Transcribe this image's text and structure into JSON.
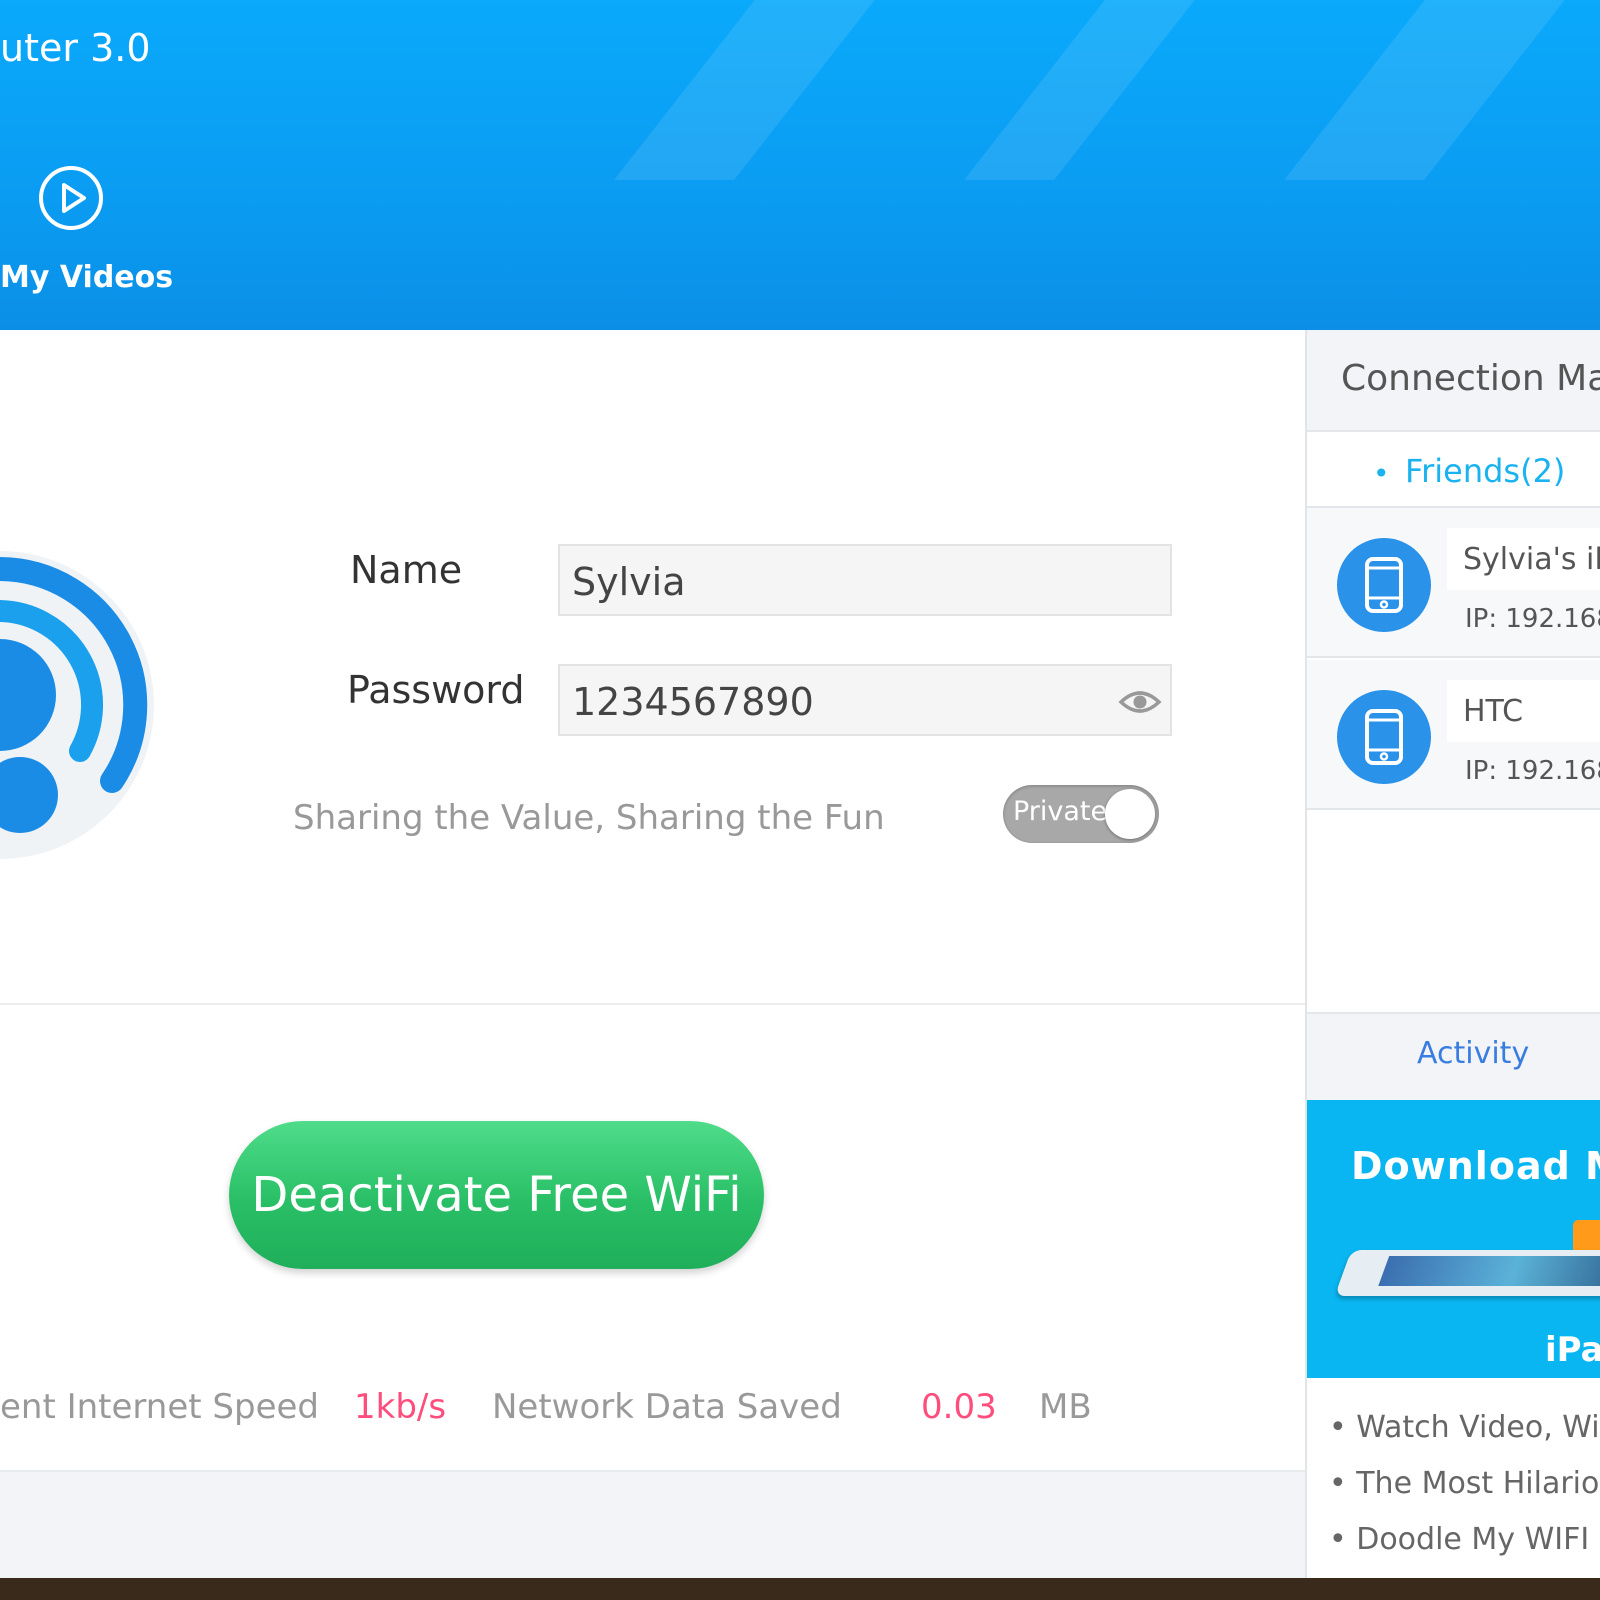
{
  "app": {
    "title": "uter 3.0"
  },
  "nav": {
    "videos_label": "My Videos"
  },
  "form": {
    "name_label": "Name",
    "name_value": "Sylvia",
    "password_label": "Password",
    "password_value": "1234567890",
    "slogan": "Sharing the Value, Sharing the Fun",
    "toggle_label": "Private"
  },
  "main": {
    "deactivate_button": "Deactivate Free WiFi",
    "speed_label": "ent Internet Speed",
    "speed_value": "1kb/s",
    "data_saved_label": "Network Data Saved",
    "data_saved_value": "0.03",
    "data_saved_unit": "MB"
  },
  "panel": {
    "title": "Connection Ma",
    "friends_tab": "Friends(2)",
    "devices": [
      {
        "name": "Sylvia's iP",
        "ip": "IP: 192.168."
      },
      {
        "name": "HTC",
        "ip": "IP: 192.168."
      }
    ],
    "activity_label": "Activity",
    "banner_title": "Download M",
    "banner_sub": "iPa",
    "news": [
      "• Watch Video, Wir",
      "• The Most Hilariou",
      "• Doodle My WIFI"
    ]
  },
  "colors": {
    "header_blue": "#0aa9fb",
    "accent_green": "#29bf66",
    "stat_pink": "#ff4d7d",
    "link_blue": "#1ab3f0"
  },
  "icons": {
    "videos": "play-circle-icon",
    "eye": "eye-icon",
    "device": "phone-icon",
    "logo": "wifi-person-icon"
  }
}
